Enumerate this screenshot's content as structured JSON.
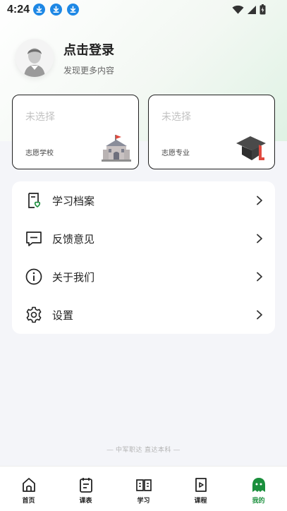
{
  "status_bar": {
    "time": "4:24"
  },
  "profile": {
    "title": "点击登录",
    "subtitle": "发现更多内容"
  },
  "cards": [
    {
      "value": "未选择",
      "label": "志愿学校",
      "icon": "school-building-icon"
    },
    {
      "value": "未选择",
      "label": "志愿专业",
      "icon": "graduation-cap-icon"
    }
  ],
  "menu": [
    {
      "label": "学习档案",
      "icon": "study-file-icon"
    },
    {
      "label": "反馈意见",
      "icon": "feedback-chat-icon"
    },
    {
      "label": "关于我们",
      "icon": "info-icon"
    },
    {
      "label": "设置",
      "icon": "gear-icon"
    }
  ],
  "footer_note": "— 中军职达 直达本科 —",
  "tabs": [
    {
      "label": "首页",
      "icon": "home-icon"
    },
    {
      "label": "课表",
      "icon": "schedule-icon"
    },
    {
      "label": "学习",
      "icon": "book-icon"
    },
    {
      "label": "课程",
      "icon": "course-play-icon"
    },
    {
      "label": "我的",
      "icon": "profile-chat-icon",
      "active": true
    }
  ],
  "colors": {
    "accent": "#1a8f3c",
    "download_badge": "#1e88e5",
    "card_border": "#1f1f1f"
  }
}
